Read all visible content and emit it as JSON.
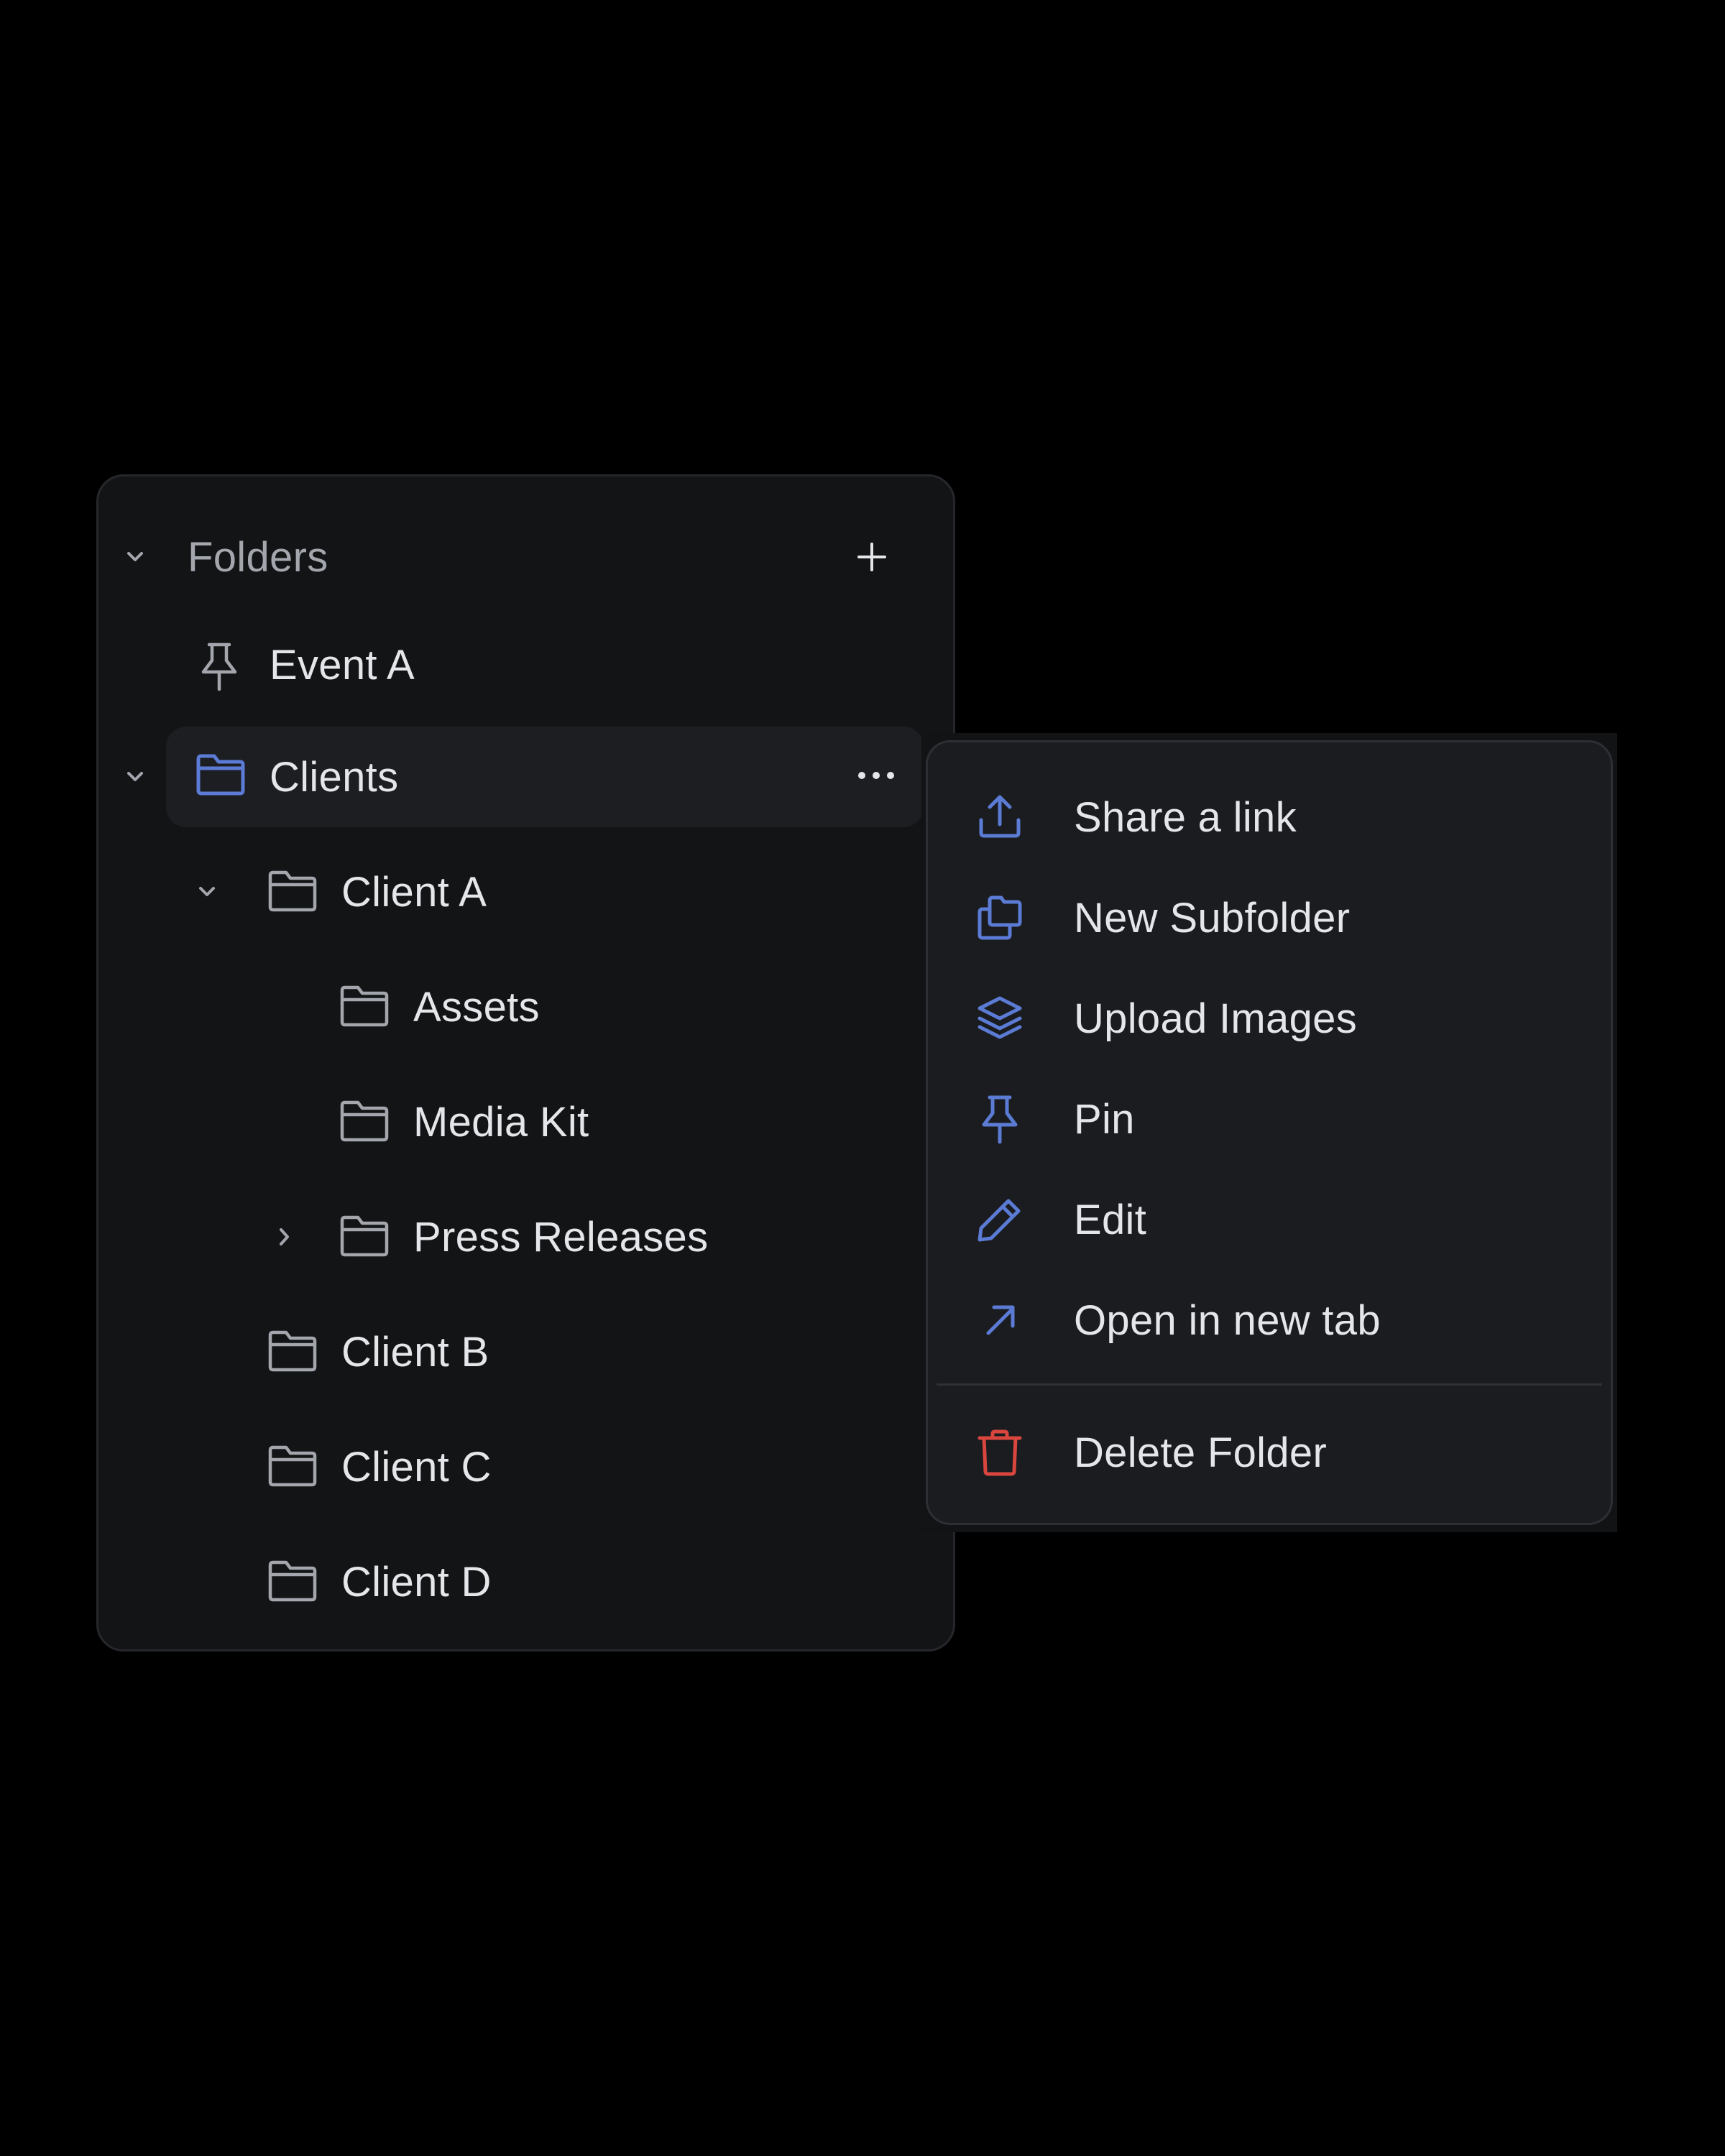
{
  "folders_panel": {
    "header_label": "Folders",
    "add_label": "+",
    "items": [
      {
        "label": "Event A",
        "icon": "pin-icon",
        "pinned": true
      },
      {
        "label": "Clients",
        "icon": "folder-icon",
        "expanded": true,
        "selected": true,
        "more_label": "•••"
      },
      {
        "label": "Client A",
        "icon": "folder-icon",
        "expanded": true
      },
      {
        "label": "Assets",
        "icon": "folder-icon"
      },
      {
        "label": "Media Kit",
        "icon": "folder-icon"
      },
      {
        "label": "Press Releases",
        "icon": "folder-icon",
        "expanded": false
      },
      {
        "label": "Client B",
        "icon": "folder-icon"
      },
      {
        "label": "Client C",
        "icon": "folder-icon"
      },
      {
        "label": "Client D",
        "icon": "folder-icon"
      }
    ]
  },
  "context_menu": {
    "items": [
      {
        "label": "Share a link",
        "icon": "share-upload-icon"
      },
      {
        "label": "New Subfolder",
        "icon": "new-subfolder-icon"
      },
      {
        "label": "Upload Images",
        "icon": "layers-icon"
      },
      {
        "label": "Pin",
        "icon": "pin-icon"
      },
      {
        "label": "Edit",
        "icon": "pencil-icon"
      },
      {
        "label": "Open in new tab",
        "icon": "arrow-up-right-icon"
      },
      {
        "label": "Delete Folder",
        "icon": "trash-icon",
        "destructive": true
      }
    ]
  },
  "colors": {
    "background": "#000000",
    "panel": "#131416",
    "selected_row": "#1c1e21",
    "accent_blue": "#5b7bd5",
    "destructive_red": "#d9463e",
    "text": "#e4e6e9",
    "muted_text": "#a3a7ad"
  }
}
